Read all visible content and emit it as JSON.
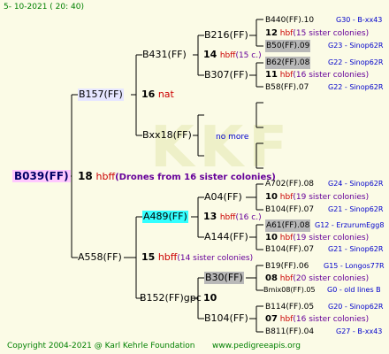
{
  "header": {
    "timestamp": "5- 10-2021 ( 20: 40)"
  },
  "footer": {
    "copyright": "Copyright 2004-2021 @ Karl Kehrle Foundation",
    "site": "www.pedigreeapis.org"
  },
  "queen": {
    "id": "B039(FF)"
  },
  "gen1": {
    "num": "18",
    "tag": "hbff",
    "note": "(Drones from 16 sister colonies)",
    "sire": {
      "id": "B157(FF)",
      "num": "16",
      "tag": "nat"
    },
    "dam": {
      "id": "A558(FF)",
      "num": "15",
      "tag": "hbff",
      "note": "(14 sister colonies)"
    }
  },
  "gen2": {
    "b431": {
      "id": "B431(FF)",
      "num": "14",
      "tag": "hbff",
      "note": "(15 c.)"
    },
    "bxx18": {
      "id": "Bxx18(FF)",
      "more": "no more"
    },
    "a489": {
      "id": "A489(FF)",
      "num": "13",
      "tag": "hbff",
      "note": "(16 c.)"
    },
    "b152": {
      "id": "B152(FF)gpc",
      "num": "10"
    }
  },
  "gen3": {
    "b216": {
      "id": "B216(FF)",
      "num": "12",
      "tag": "hbf",
      "note": "(15 sister colonies)"
    },
    "b307": {
      "id": "B307(FF)",
      "num": "11",
      "tag": "hbf",
      "note": "(16 sister colonies)"
    },
    "a04": {
      "id": "A04(FF)",
      "num": "10",
      "tag": "hbf",
      "note": "(19 sister colonies)"
    },
    "a144": {
      "id": "A144(FF)",
      "num": "10",
      "tag": "hbf",
      "note": "(19 sister colonies)"
    },
    "b30": {
      "id": "B30(FF)",
      "num": "08",
      "tag": "hbf",
      "note": "(20 sister colonies)"
    },
    "b104": {
      "id": "B104(FF)",
      "num": "07",
      "tag": "hbf",
      "note": "(16 sister colonies)"
    }
  },
  "gen4": [
    {
      "id": "B440(FF).10",
      "origin": "G30 - B-xx43"
    },
    {
      "id": "B50(FF).09",
      "origin": "G23 - Sinop62R"
    },
    {
      "id": "B62(FF).08",
      "origin": "G22 - Sinop62R"
    },
    {
      "id": "B58(FF).07",
      "origin": "G22 - Sinop62R"
    },
    {
      "id": "A702(FF).08",
      "origin": "G24 - Sinop62R"
    },
    {
      "id": "B104(FF).07",
      "origin": "G21 - Sinop62R"
    },
    {
      "id": "A61(FF).08",
      "origin": "G12 - ErzurumEgg8"
    },
    {
      "id": "B104(FF).07",
      "origin": "G21 - Sinop62R"
    },
    {
      "id": "B19(FF).06",
      "origin": "G15 - Longos77R"
    },
    {
      "id": "Bmix08(FF).05",
      "origin": "G0 - old lines B"
    },
    {
      "id": "B114(FF).05",
      "origin": "G20 - Sinop62R"
    },
    {
      "id": "B811(FF).04",
      "origin": "G27 - B-xx43"
    }
  ]
}
